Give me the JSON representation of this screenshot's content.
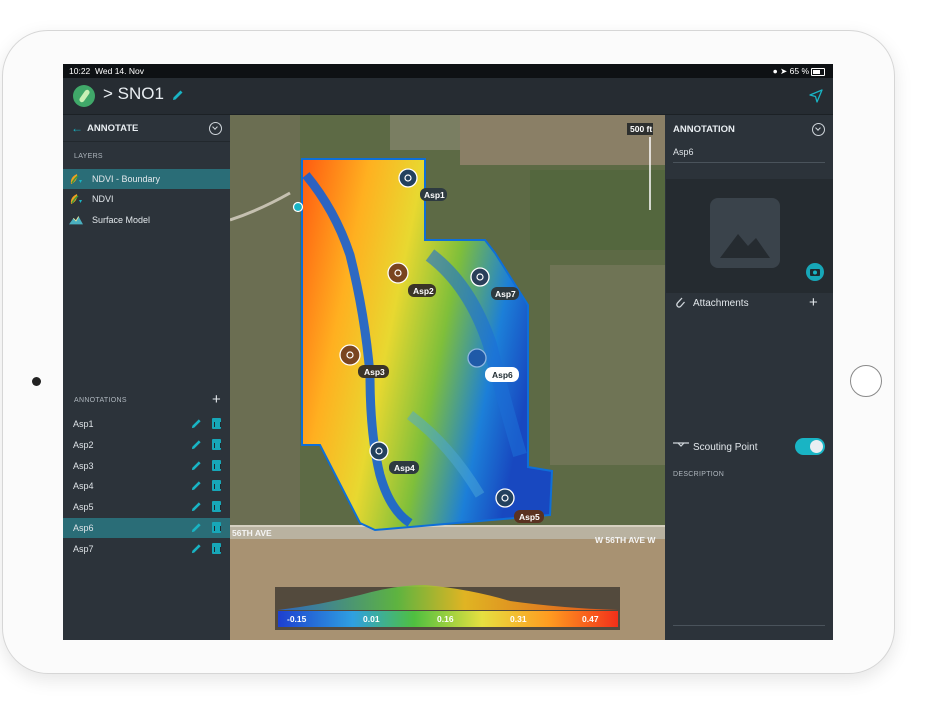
{
  "status_bar": {
    "time": "10:22",
    "date": "Wed 14. Nov",
    "battery": "65 %"
  },
  "header": {
    "title": "> SNO1"
  },
  "left_panel": {
    "title": "ANNOTATE",
    "layers_label": "LAYERS",
    "layers": [
      {
        "name": "NDVI - Boundary",
        "selected": true
      },
      {
        "name": "NDVI",
        "selected": false
      },
      {
        "name": "Surface Model",
        "selected": false
      }
    ],
    "annotations_label": "ANNOTATIONS",
    "annotations": [
      {
        "name": "Asp1",
        "selected": false
      },
      {
        "name": "Asp2",
        "selected": false
      },
      {
        "name": "Asp3",
        "selected": false
      },
      {
        "name": "Asp4",
        "selected": false
      },
      {
        "name": "Asp5",
        "selected": false
      },
      {
        "name": "Asp6",
        "selected": true
      },
      {
        "name": "Asp7",
        "selected": false
      }
    ]
  },
  "map": {
    "scale_label": "500 ft",
    "road_label_left": "56TH AVE",
    "road_label_right": "W 56TH AVE  W",
    "markers": [
      {
        "label": "Asp1"
      },
      {
        "label": "Asp2"
      },
      {
        "label": "Asp7"
      },
      {
        "label": "Asp3"
      },
      {
        "label": "Asp6"
      },
      {
        "label": "Asp4"
      },
      {
        "label": "Asp5"
      }
    ],
    "legend_ticks": [
      "-0.15",
      "0.01",
      "0.16",
      "0.31",
      "0.47"
    ]
  },
  "right_panel": {
    "title": "ANNOTATION",
    "name": "Asp6",
    "attachments_label": "Attachments",
    "scouting_label": "Scouting Point",
    "scouting_on": true,
    "description_label": "DESCRIPTION"
  },
  "colors": {
    "accent": "#19b4c4",
    "selection": "#2a6d77",
    "panel": "#2c333a",
    "header": "#262c32"
  }
}
